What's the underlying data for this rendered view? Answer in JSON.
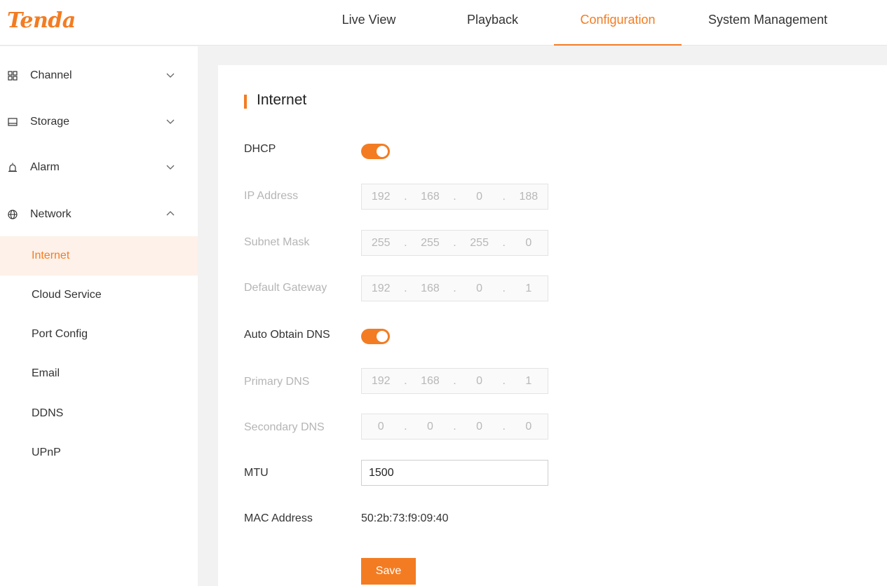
{
  "brand": {
    "logo_text": "Tenda",
    "accent": "#f37c22"
  },
  "nav": {
    "items": [
      {
        "label": "Live View"
      },
      {
        "label": "Playback"
      },
      {
        "label": "Configuration",
        "active": true
      },
      {
        "label": "System Management"
      }
    ]
  },
  "sidebar": {
    "groups": [
      {
        "label": "Channel",
        "icon": "grid-icon",
        "expanded": false
      },
      {
        "label": "Storage",
        "icon": "storage-icon",
        "expanded": false
      },
      {
        "label": "Alarm",
        "icon": "alarm-icon",
        "expanded": false
      },
      {
        "label": "Network",
        "icon": "globe-icon",
        "expanded": true
      }
    ],
    "network_items": [
      {
        "label": "Internet",
        "active": true
      },
      {
        "label": "Cloud Service"
      },
      {
        "label": "Port Config"
      },
      {
        "label": "Email"
      },
      {
        "label": "DDNS"
      },
      {
        "label": "UPnP"
      }
    ]
  },
  "form": {
    "title": "Internet",
    "dhcp": {
      "label": "DHCP",
      "enabled": true
    },
    "ip_address": {
      "label": "IP Address",
      "octets": [
        "192",
        "168",
        "0",
        "188"
      ]
    },
    "subnet_mask": {
      "label": "Subnet Mask",
      "octets": [
        "255",
        "255",
        "255",
        "0"
      ]
    },
    "default_gateway": {
      "label": "Default Gateway",
      "octets": [
        "192",
        "168",
        "0",
        "1"
      ]
    },
    "auto_dns": {
      "label": "Auto Obtain DNS",
      "enabled": true
    },
    "primary_dns": {
      "label": "Primary DNS",
      "octets": [
        "192",
        "168",
        "0",
        "1"
      ]
    },
    "secondary_dns": {
      "label": "Secondary DNS",
      "octets": [
        "0",
        "0",
        "0",
        "0"
      ]
    },
    "mtu": {
      "label": "MTU",
      "value": "1500"
    },
    "mac": {
      "label": "MAC Address",
      "value": "50:2b:73:f9:09:40"
    },
    "save_label": "Save"
  }
}
